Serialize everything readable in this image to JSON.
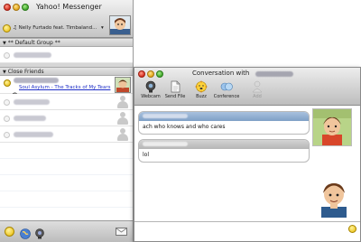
{
  "main_window": {
    "title": "Yahoo! Messenger",
    "status_text": "♫ Nelly Furtado feat. Timbaland...",
    "status_dropdown_arrow": "▾",
    "groups": [
      {
        "label": "** Default Group **",
        "arrow": "▼"
      },
      {
        "label": "Close Friends",
        "arrow": "▼"
      }
    ],
    "contact_status_link": "Soul Asylum - The Tracks of My Tears",
    "footer_icons": [
      "smiley-icon",
      "globe-icon",
      "webcam-icon",
      "mail-icon"
    ]
  },
  "conversation_window": {
    "title": "Conversation with",
    "toolbar": [
      {
        "label": "Webcam",
        "icon": "webcam-icon"
      },
      {
        "label": "Send File",
        "icon": "document-icon"
      },
      {
        "label": "Buzz",
        "icon": "buzz-icon"
      },
      {
        "label": "Conference",
        "icon": "conference-icon"
      },
      {
        "label": "Add",
        "icon": "add-contact-icon"
      }
    ],
    "messages": [
      {
        "text": "ach who knows and who cares"
      },
      {
        "text": "lol"
      }
    ]
  },
  "colors": {
    "link_blue": "#2030c8",
    "bubble_header": "#8eaad0",
    "window_gray": "#e6e6e6"
  }
}
